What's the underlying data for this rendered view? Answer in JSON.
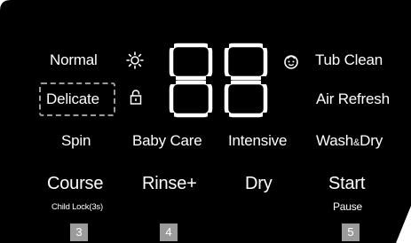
{
  "panel": {
    "display": {
      "digits": "88"
    },
    "options": {
      "normal": "Normal",
      "delicate": "Delicate",
      "spin": "Spin",
      "baby_care": "Baby Care",
      "intensive": "Intensive",
      "tub_clean": "Tub Clean",
      "air_refresh": "Air Refresh",
      "wash_dry": "Wash",
      "wash_dry_amp": "&",
      "wash_dry_end": "Dry"
    },
    "buttons": {
      "course": "Course",
      "course_sub": "Child Lock(3s)",
      "rinse": "Rinse+",
      "dry": "Dry",
      "start": "Start",
      "start_sub": "Pause"
    },
    "badges": [
      "3",
      "4",
      "5"
    ],
    "icons": {
      "sun": "sun-icon",
      "lock": "lock-icon",
      "smiley": "smiley-icon"
    },
    "colors": {
      "panel": "#000000",
      "text": "#ffffff",
      "badge": "#9b9b9b",
      "dashed_box": "#9c9c9c"
    }
  }
}
